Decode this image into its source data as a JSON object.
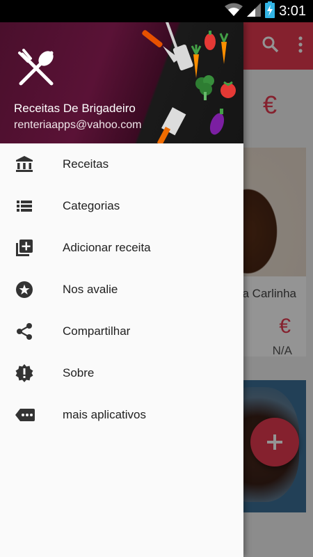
{
  "status_bar": {
    "time": "3:01"
  },
  "drawer": {
    "header": {
      "app_name": "Receitas De Brigadeiro",
      "email": "renteriaapps@vahoo.com"
    },
    "items": [
      {
        "label": "Receitas",
        "icon": "bank-icon"
      },
      {
        "label": "Categorias",
        "icon": "list-icon"
      },
      {
        "label": "Adicionar receita",
        "icon": "add-to-library-icon"
      },
      {
        "label": "Nos avalie",
        "icon": "star-circle-icon"
      },
      {
        "label": "Compartilhar",
        "icon": "share-icon"
      },
      {
        "label": "Sobre",
        "icon": "info-badge-icon"
      },
      {
        "label": "mais aplicativos",
        "icon": "more-tag-icon"
      }
    ]
  },
  "background": {
    "currency_symbol": "€",
    "card1": {
      "title_partial": "a Carlinha",
      "currency": "€",
      "price": "N/A"
    }
  },
  "colors": {
    "accent": "#e53950",
    "drawer_header": "#4a0f2c"
  }
}
